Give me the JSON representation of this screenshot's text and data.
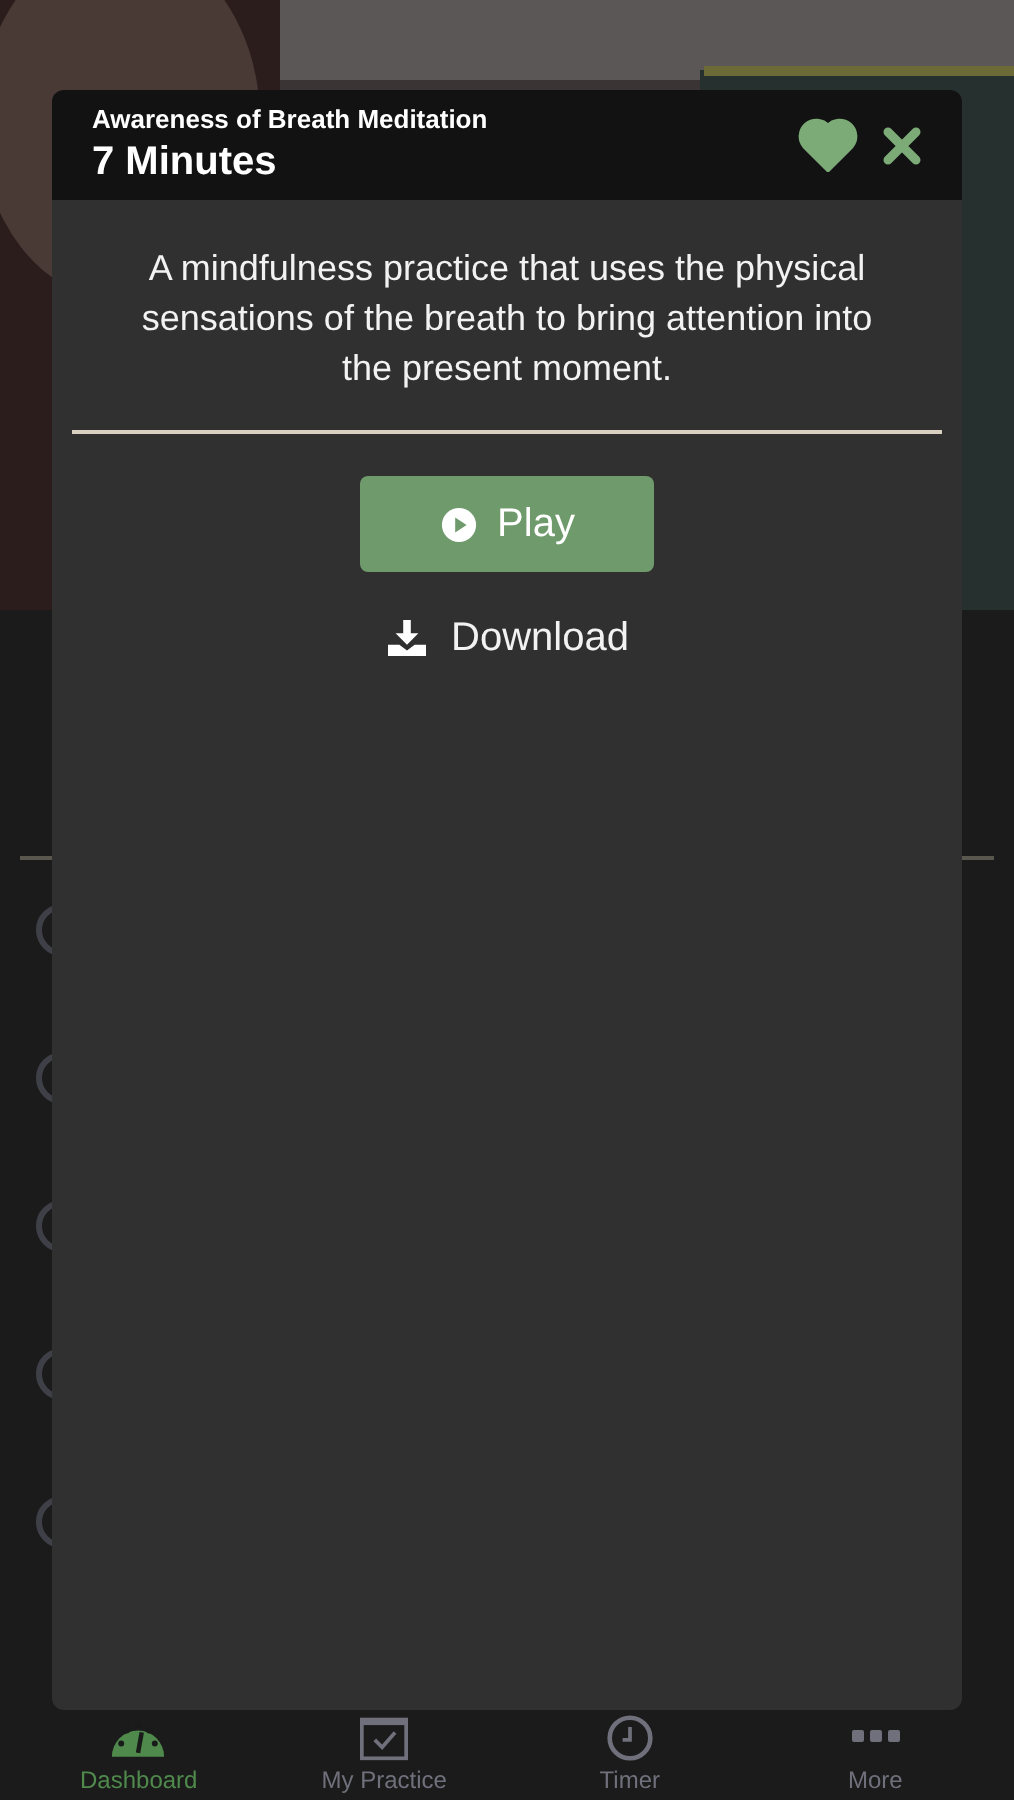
{
  "tab_bar": [
    {
      "label": "Dashboard",
      "kind": "gauge",
      "selected": true
    },
    {
      "label": "My Practice",
      "kind": "calendar",
      "selected": false
    },
    {
      "label": "Timer",
      "kind": "clock",
      "selected": false
    },
    {
      "label": "More",
      "kind": "dots",
      "selected": false
    }
  ],
  "modal": {
    "subtitle": "Awareness of Breath Meditation",
    "title": "7 Minutes",
    "favorite": true,
    "description": "A mindfulness practice that uses the physical sensations of the breath to bring attention into the present moment.",
    "play_button": "Play",
    "download_button": "Download"
  }
}
